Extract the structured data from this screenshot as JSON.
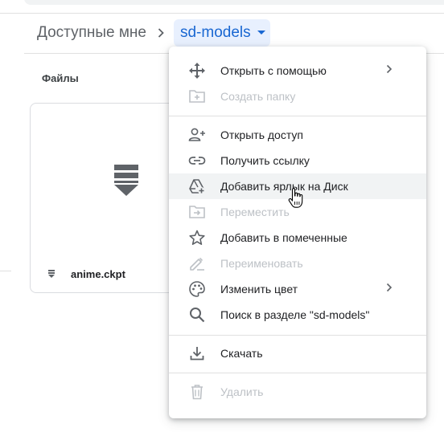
{
  "breadcrumb": {
    "root": "Доступные мне",
    "current": "sd-models"
  },
  "files_section": {
    "heading": "Файлы"
  },
  "file_card": {
    "name": "anime.ckpt",
    "icon": "download-file-icon"
  },
  "context_menu": {
    "items": [
      {
        "label": "Открыть с помощью",
        "icon": "open-with-icon",
        "enabled": true,
        "submenu": true
      },
      {
        "label": "Создать папку",
        "icon": "new-folder-icon",
        "enabled": false,
        "submenu": false
      },
      {
        "label": "Открыть доступ",
        "icon": "add-person-icon",
        "enabled": true,
        "submenu": false
      },
      {
        "label": "Получить ссылку",
        "icon": "link-icon",
        "enabled": true,
        "submenu": false
      },
      {
        "label": "Добавить ярлык на Диск",
        "icon": "add-to-drive-icon",
        "enabled": true,
        "submenu": false,
        "hovered": true
      },
      {
        "label": "Переместить",
        "icon": "move-folder-icon",
        "enabled": false,
        "submenu": false
      },
      {
        "label": "Добавить в помеченные",
        "icon": "star-icon",
        "enabled": true,
        "submenu": false
      },
      {
        "label": "Переименовать",
        "icon": "rename-pencil-icon",
        "enabled": false,
        "submenu": false
      },
      {
        "label": "Изменить цвет",
        "icon": "palette-icon",
        "enabled": true,
        "submenu": true
      },
      {
        "label": "Поиск в разделе \"sd-models\"",
        "icon": "search-icon",
        "enabled": true,
        "submenu": false
      },
      {
        "label": "Скачать",
        "icon": "download-icon",
        "enabled": true,
        "submenu": false
      },
      {
        "label": "Удалить",
        "icon": "trash-icon",
        "enabled": false,
        "submenu": false
      }
    ]
  },
  "colors": {
    "accent": "#1967d2",
    "accent_bg": "#e8f0fe",
    "text": "#202124",
    "icon": "#5f6368",
    "disabled": "#bdc1c6",
    "hover_bg": "#f1f3f4"
  }
}
